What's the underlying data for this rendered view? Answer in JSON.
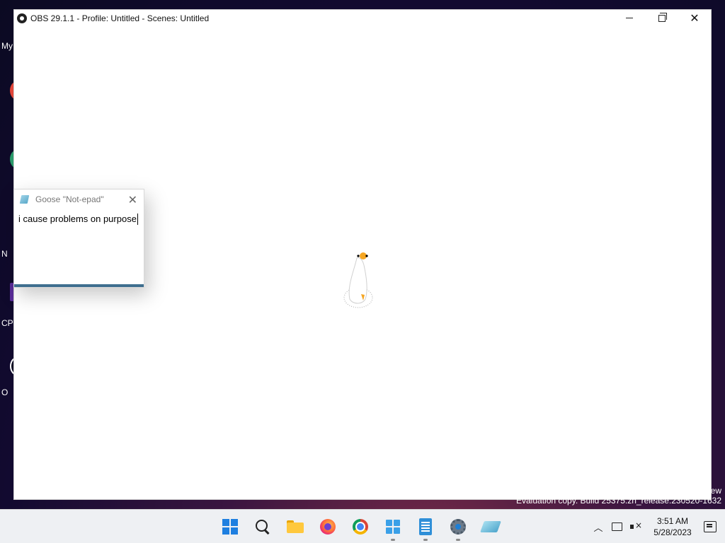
{
  "desktop": {
    "icon_fragments": [
      "My",
      "N",
      "CP",
      "O"
    ]
  },
  "obs": {
    "title": "OBS 29.1.1 - Profile: Untitled - Scenes: Untitled"
  },
  "goose_notepad": {
    "title": "Goose \"Not-epad\"",
    "text": "i cause problems on purpose"
  },
  "watermark": {
    "line1": "ew",
    "line2": "Evaluation copy. Build 25375.zn_release.230520-1632"
  },
  "taskbar": {
    "apps": [
      "start",
      "search",
      "file-explorer",
      "firefox",
      "chrome",
      "microsoft-store",
      "notepad",
      "settings",
      "goose-notepad"
    ],
    "time": "3:51 AM",
    "date": "5/28/2023"
  },
  "colors": {
    "accent": "#1e7fe0",
    "notepad_bar": "#3f6f8f",
    "goose_beak": "#f5a623"
  }
}
